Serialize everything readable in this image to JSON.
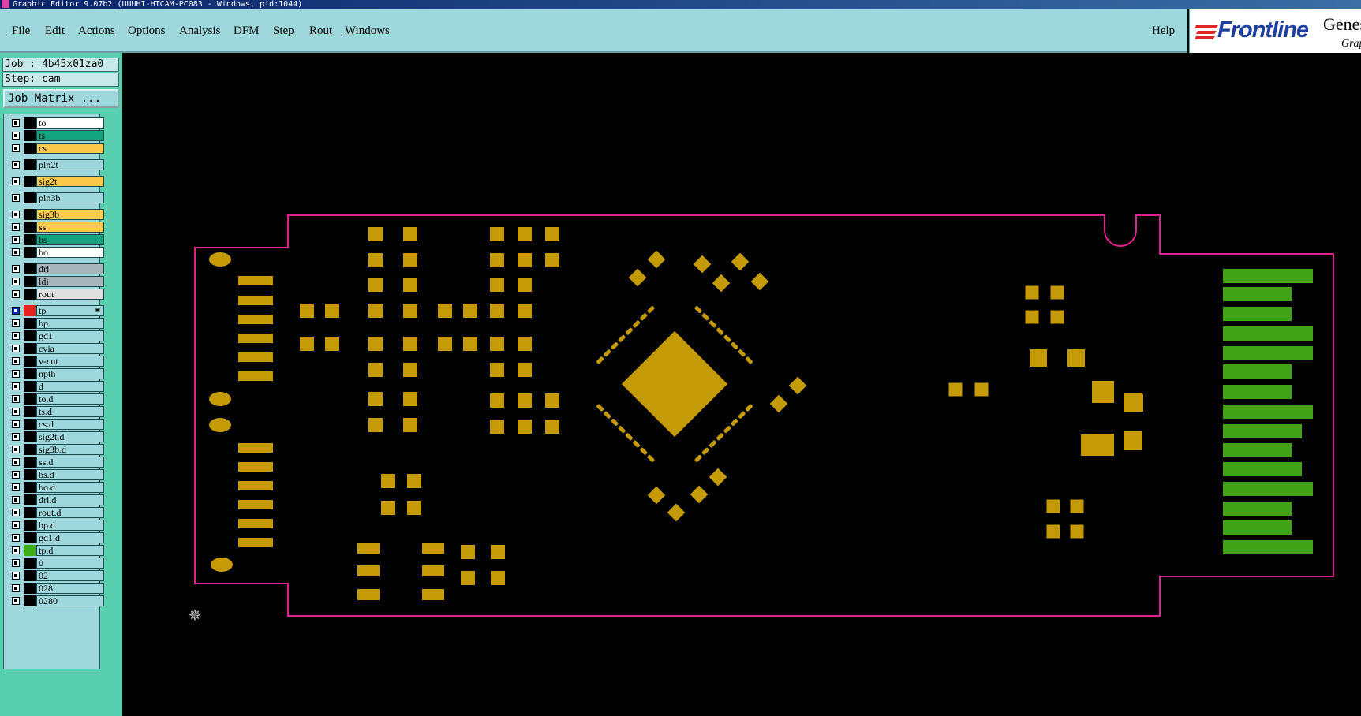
{
  "window": {
    "title": "Graphic Editor 9.07b2 (UUUHI-HTCAM-PC083 - Windows, pid:1044)"
  },
  "menu": {
    "items": [
      {
        "id": "file",
        "label": "File"
      },
      {
        "id": "edit",
        "label": "Edit"
      },
      {
        "id": "actions",
        "label": "Actions"
      },
      {
        "id": "options",
        "label": "Options"
      },
      {
        "id": "analysis",
        "label": "Analysis"
      },
      {
        "id": "dfm",
        "label": "DFM"
      },
      {
        "id": "step",
        "label": "Step"
      },
      {
        "id": "rout",
        "label": "Rout"
      },
      {
        "id": "windows",
        "label": "Windows"
      }
    ],
    "help": "Help"
  },
  "logo": {
    "brand": "Frontline",
    "product": "Genesis",
    "subtitle": "Graphic"
  },
  "job": {
    "job_label": "Job : 4b45x01za0",
    "step_label": "Step: cam",
    "matrix_button": "Job Matrix ..."
  },
  "layers": [
    {
      "name": "to",
      "color": "#ffffff",
      "group": 0
    },
    {
      "name": "ts",
      "color": "#13a37f",
      "group": 0
    },
    {
      "name": "cs",
      "color": "#fbc94c",
      "group": 0
    },
    {
      "name": "pln2t",
      "color": "#9fd8dc",
      "group": 1
    },
    {
      "name": "sig2t",
      "color": "#fbc94c",
      "group": 2
    },
    {
      "name": "pln3b",
      "color": "#9fd8dc",
      "group": 3
    },
    {
      "name": "sig3b",
      "color": "#fbc94c",
      "group": 4
    },
    {
      "name": "ss",
      "color": "#fbc94c",
      "group": 4
    },
    {
      "name": "bs",
      "color": "#13a37f",
      "group": 4
    },
    {
      "name": "bo",
      "color": "#ffffff",
      "group": 4
    },
    {
      "name": "drl",
      "color": "#a8b4bc",
      "group": 5
    },
    {
      "name": "ldi",
      "color": "#a8b4bc",
      "group": 5
    },
    {
      "name": "rout",
      "color": "#e0e0e0",
      "group": 5
    },
    {
      "name": "tp",
      "color": "#9fd8dc",
      "group": 6,
      "active": true,
      "swatch": "#e82020"
    },
    {
      "name": "bp",
      "color": "#9fd8dc",
      "group": 6
    },
    {
      "name": "gd1",
      "color": "#9fd8dc",
      "group": 6
    },
    {
      "name": "cvia",
      "color": "#9fd8dc",
      "group": 6
    },
    {
      "name": "v-cut",
      "color": "#9fd8dc",
      "group": 6
    },
    {
      "name": "npth",
      "color": "#9fd8dc",
      "group": 6
    },
    {
      "name": "d",
      "color": "#9fd8dc",
      "group": 6
    },
    {
      "name": "to.d",
      "color": "#9fd8dc",
      "group": 6
    },
    {
      "name": "ts.d",
      "color": "#9fd8dc",
      "group": 6
    },
    {
      "name": "cs.d",
      "color": "#9fd8dc",
      "group": 6
    },
    {
      "name": "sig2t.d",
      "color": "#9fd8dc",
      "group": 6
    },
    {
      "name": "sig3b.d",
      "color": "#9fd8dc",
      "group": 6
    },
    {
      "name": "ss.d",
      "color": "#9fd8dc",
      "group": 6
    },
    {
      "name": "bs.d",
      "color": "#9fd8dc",
      "group": 6
    },
    {
      "name": "bo.d",
      "color": "#9fd8dc",
      "group": 6
    },
    {
      "name": "drl.d",
      "color": "#9fd8dc",
      "group": 6
    },
    {
      "name": "rout.d",
      "color": "#9fd8dc",
      "group": 6
    },
    {
      "name": "bp.d",
      "color": "#9fd8dc",
      "group": 6
    },
    {
      "name": "gd1.d",
      "color": "#9fd8dc",
      "group": 6
    },
    {
      "name": "tp.d",
      "color": "#9fd8dc",
      "group": 6,
      "swatch": "#3fae19"
    },
    {
      "name": "0",
      "color": "#9fd8dc",
      "group": 6
    },
    {
      "name": "02",
      "color": "#9fd8dc",
      "group": 6
    },
    {
      "name": "028",
      "color": "#9fd8dc",
      "group": 6
    },
    {
      "name": "0280",
      "color": "#9fd8dc",
      "group": 6
    }
  ],
  "colors": {
    "pad": "#c49a06",
    "outline": "#e0228f",
    "finger": "#3fa217",
    "background": "#000000"
  },
  "icons": {
    "cursor": "crosshair-snowflake-icon"
  }
}
